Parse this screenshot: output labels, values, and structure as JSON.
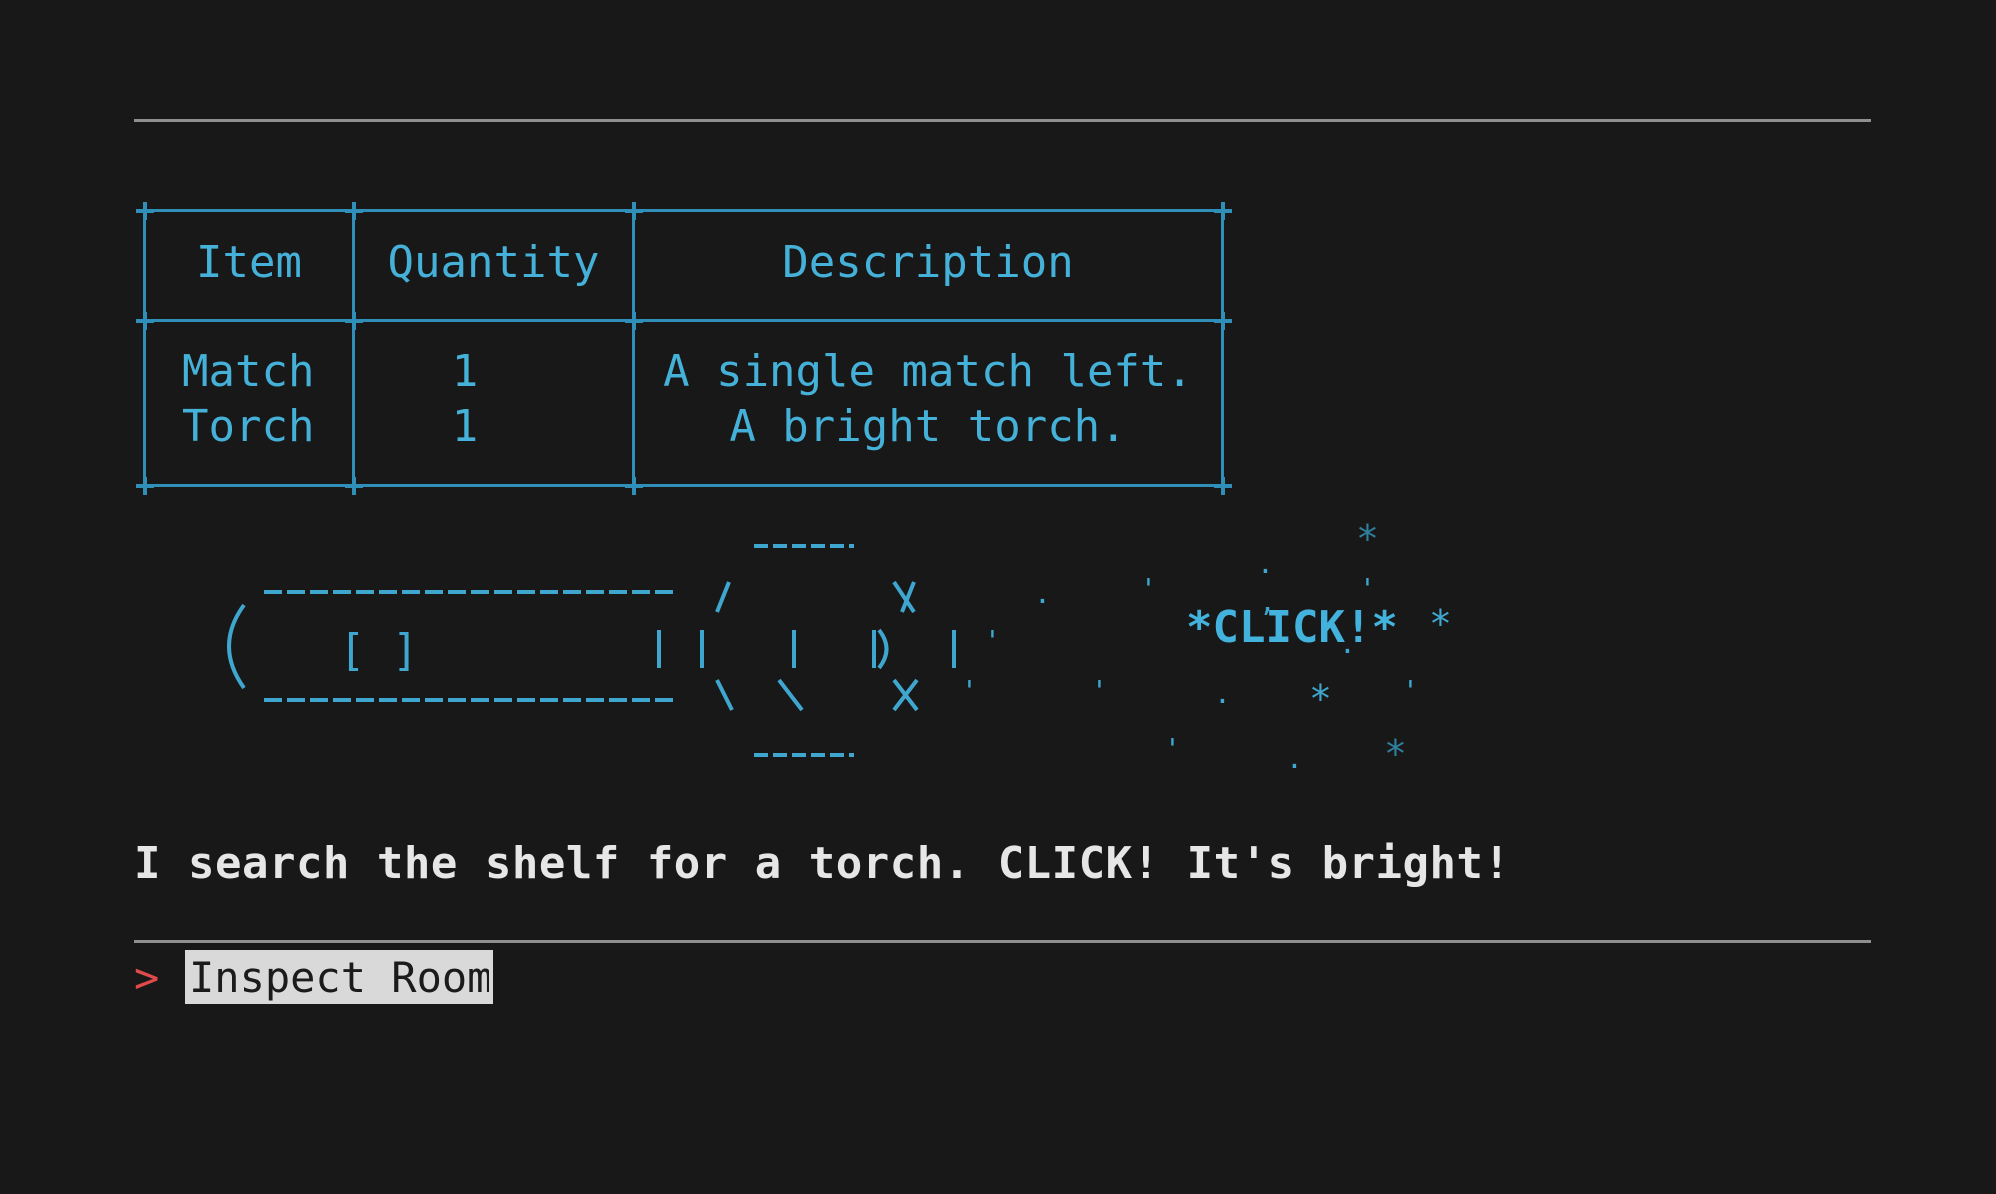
{
  "inventory": {
    "headers": {
      "item": "Item",
      "quantity": "Quantity",
      "description": "Description"
    },
    "rows": [
      {
        "item": "Match",
        "quantity": "1",
        "description": "A single match left."
      },
      {
        "item": "Torch",
        "quantity": "1",
        "description": "A bright torch."
      }
    ]
  },
  "art": {
    "click_text": "*CLICK!*",
    "handle_text": "[ ]"
  },
  "narration": "I search the shelf for a torch. CLICK! It's bright!",
  "prompt": {
    "symbol": ">",
    "value": "Inspect Room"
  },
  "colors": {
    "background": "#181818",
    "ascii_cyan": "#3fa7cf",
    "narration": "#e6e6e6",
    "prompt_symbol": "#e04a4a",
    "input_highlight": "#d9d9d9"
  }
}
